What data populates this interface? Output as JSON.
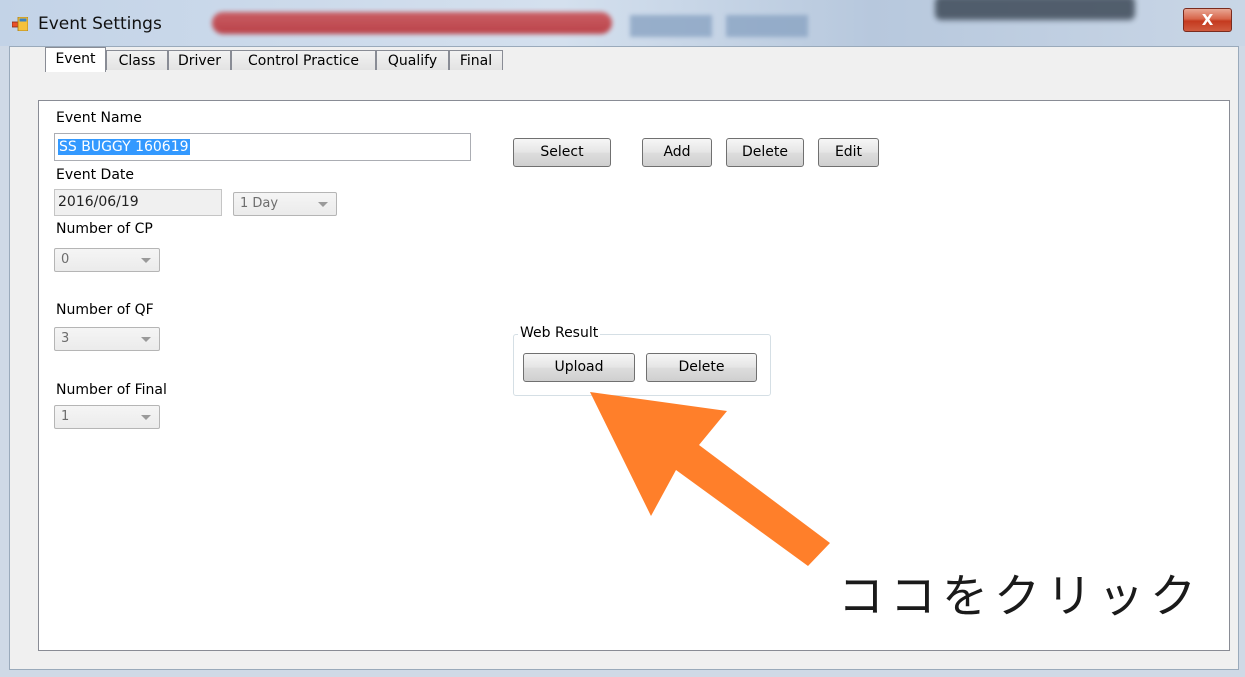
{
  "window": {
    "title": "Event Settings",
    "close_label": "X"
  },
  "tabs": [
    {
      "label": "Event",
      "active": true
    },
    {
      "label": "Class",
      "active": false
    },
    {
      "label": "Driver",
      "active": false
    },
    {
      "label": "Control Practice",
      "active": false
    },
    {
      "label": "Qualify",
      "active": false
    },
    {
      "label": "Final",
      "active": false
    }
  ],
  "event": {
    "name_label": "Event Name",
    "name_value": "SS BUGGY 160619",
    "date_label": "Event Date",
    "date_value": "2016/06/19",
    "duration_value": "1 Day",
    "cp_label": "Number of CP",
    "cp_value": "0",
    "qf_label": "Number of QF",
    "qf_value": "3",
    "final_label": "Number of Final",
    "final_value": "1"
  },
  "actions": {
    "select_label": "Select",
    "add_label": "Add",
    "delete_label": "Delete",
    "edit_label": "Edit"
  },
  "web_result": {
    "group_label": "Web Result",
    "upload_label": "Upload",
    "delete_label": "Delete"
  },
  "annotation": {
    "text": "ココをクリック",
    "arrow_color": "#ff7f2a"
  },
  "colors": {
    "selection": "#3399ff",
    "close_button": "#c43a1f"
  }
}
